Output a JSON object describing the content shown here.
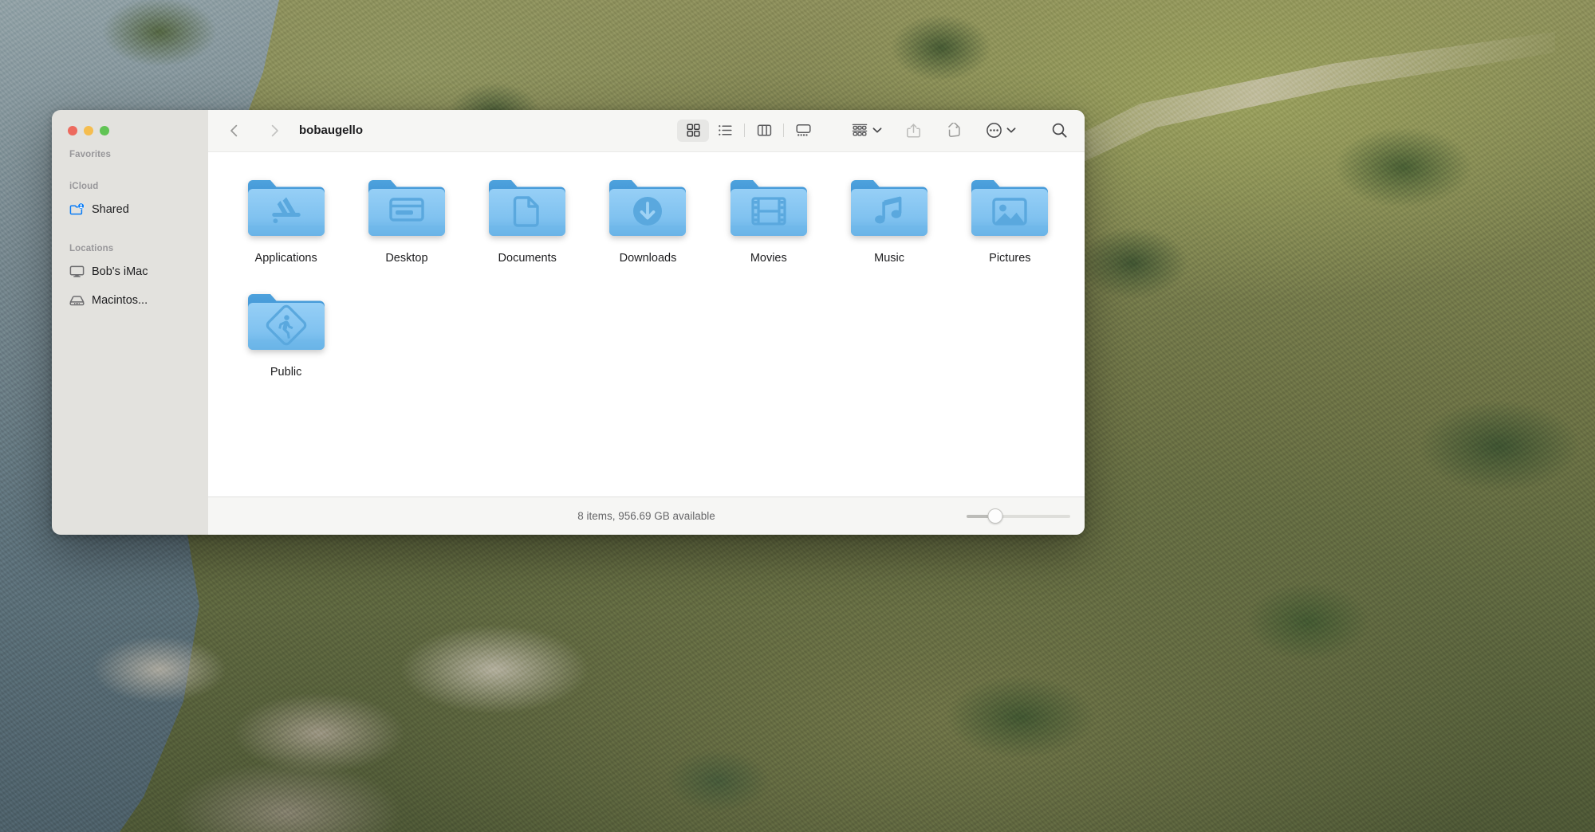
{
  "window": {
    "title": "bobaugello",
    "traffic_lights": [
      {
        "name": "close",
        "color": "#ED6A5E"
      },
      {
        "name": "minimize",
        "color": "#F5BD4F"
      },
      {
        "name": "zoom",
        "color": "#61C454"
      }
    ]
  },
  "sidebar": {
    "sections": [
      {
        "title": "Favorites",
        "items": []
      },
      {
        "title": "iCloud",
        "items": [
          {
            "label": "Shared",
            "icon": "shared-folder-icon",
            "color": "#0a7cf5"
          }
        ]
      },
      {
        "title": "Locations",
        "items": [
          {
            "label": "Bob's iMac",
            "icon": "display-icon",
            "color": "#6e6e70"
          },
          {
            "label": "Macintos...",
            "icon": "hard-drive-icon",
            "color": "#6e6e70"
          }
        ]
      }
    ]
  },
  "toolbar": {
    "back_label": "Back",
    "forward_label": "Forward",
    "view_modes": [
      {
        "name": "icon-view",
        "label": "Icon View",
        "active": true
      },
      {
        "name": "list-view",
        "label": "List View",
        "active": false
      },
      {
        "name": "column-view",
        "label": "Column View",
        "active": false
      },
      {
        "name": "gallery-view",
        "label": "Gallery View",
        "active": false
      }
    ],
    "group_label": "Group",
    "share_label": "Share",
    "tags_label": "Tags",
    "more_label": "More",
    "search_label": "Search"
  },
  "main": {
    "items": [
      {
        "label": "Applications",
        "icon": "applications-folder-icon"
      },
      {
        "label": "Desktop",
        "icon": "desktop-folder-icon"
      },
      {
        "label": "Documents",
        "icon": "documents-folder-icon"
      },
      {
        "label": "Downloads",
        "icon": "downloads-folder-icon"
      },
      {
        "label": "Movies",
        "icon": "movies-folder-icon"
      },
      {
        "label": "Music",
        "icon": "music-folder-icon"
      },
      {
        "label": "Pictures",
        "icon": "pictures-folder-icon"
      },
      {
        "label": "Public",
        "icon": "public-folder-icon"
      }
    ]
  },
  "status": {
    "text": "8 items, 956.69 GB available",
    "zoom_percent": 28
  },
  "colors": {
    "folder_body_top": "#8ECBF4",
    "folder_body_bottom": "#6BB6E8",
    "folder_tab": "#3F96D8",
    "folder_glyph": "#5AA7DE",
    "sidebar_bg": "#E3E2DE",
    "toolbar_bg": "#F6F6F4",
    "content_bg": "#FFFFFF",
    "accent_blue": "#0A7CF5"
  }
}
